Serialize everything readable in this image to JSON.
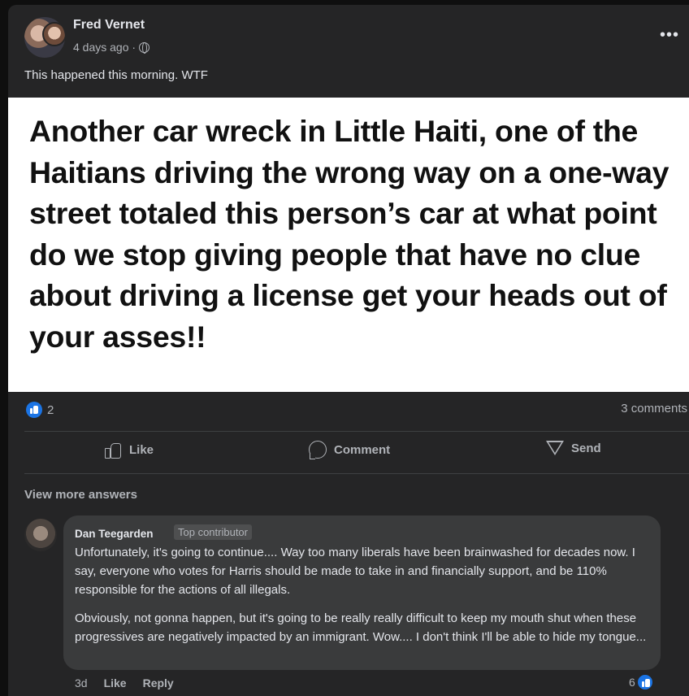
{
  "post": {
    "author": "Fred Vernet",
    "time": "4 days ago ·",
    "caption": "This happened this morning. WTF",
    "image_text": "Another car wreck in Little Haiti, one of the Haitians driving the wrong way on a one-way street totaled this person’s car at what point do we stop giving people that have no clue about driving a license get your heads out of your asses!!",
    "reaction_count": "2",
    "comments_count": "3 comments"
  },
  "actions": {
    "like": "Like",
    "comment": "Comment",
    "send": "Send"
  },
  "comments_section": {
    "view_more": "View more answers",
    "comment": {
      "author": "Dan Teegarden",
      "badge": "Top contributor",
      "paragraph1": "Unfortunately, it's going to continue.... Way too many liberals have been brainwashed for decades now. I say, everyone who votes for Harris should be made to take in and financially support, and be 110% responsible for the actions of all illegals.",
      "paragraph2": "Obviously, not gonna happen, but it's going to be really really difficult to keep my mouth shut when these progressives are negatively impacted by an immigrant. Wow.... I don't think I'll be able to hide my tongue...",
      "time": "3d",
      "like": "Like",
      "reply": "Reply",
      "reaction_count": "6"
    }
  },
  "colors": {
    "background": "#252526",
    "bubble": "#3a3b3c",
    "accent": "#1b74e4"
  }
}
